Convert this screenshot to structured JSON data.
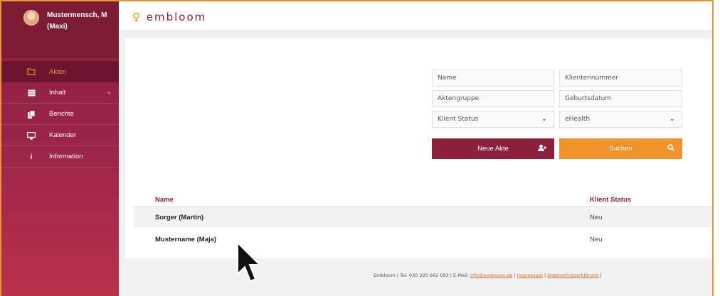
{
  "user": {
    "name_line1": "Mustermensch, M",
    "name_line2": "(Maxi)"
  },
  "brand": {
    "logo_text": "embloom",
    "primary": "#8c1f3c",
    "accent": "#f0932a"
  },
  "sidebar": {
    "items": [
      {
        "label": "Akten",
        "icon": "folder-icon",
        "active": true
      },
      {
        "label": "Inhalt",
        "icon": "table-icon",
        "has_submenu": true
      },
      {
        "label": "Berichte",
        "icon": "report-icon"
      },
      {
        "label": "Kalender",
        "icon": "monitor-icon"
      },
      {
        "label": "Information",
        "icon": "info-icon"
      }
    ]
  },
  "search": {
    "name_placeholder": "Name",
    "klientennummer_placeholder": "Klientennummer",
    "aktengruppe_placeholder": "Aktengruppe",
    "geburtsdatum_placeholder": "Geburtsdatum",
    "klient_status_value": "Klient Status",
    "ehealth_value": "eHealth",
    "new_button_label": "Neue Akte",
    "search_button_label": "Suchen"
  },
  "table": {
    "headers": {
      "name": "Name",
      "status": "Klient Status"
    },
    "rows": [
      {
        "name": "Sorger (Martin)",
        "status": "Neu"
      },
      {
        "name": "Mustername (Maja)",
        "status": "Neu"
      }
    ]
  },
  "footer": {
    "prefix": "Embloom | Tel: 030 220 662 093 | E-Mail: ",
    "email": "info@embloom.de",
    "sep1": " | ",
    "impressum": "Impressum",
    "sep2": " | ",
    "datenschutz": "Datenschutzerklärung",
    "suffix": " |"
  }
}
